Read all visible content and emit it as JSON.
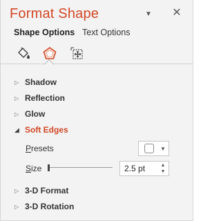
{
  "pane": {
    "title": "Format Shape",
    "dropdown_glyph": "▼",
    "close_glyph": "✕"
  },
  "tabs": {
    "shape_options": "Shape Options",
    "text_options": "Text Options"
  },
  "icons": {
    "fill": "fill-line-icon",
    "effects": "effects-icon",
    "size": "size-properties-icon"
  },
  "sections": {
    "shadow": "Shadow",
    "reflection": "Reflection",
    "glow": "Glow",
    "soft_edges": "Soft Edges",
    "format_3d": "3-D Format",
    "rotation_3d": "3-D Rotation"
  },
  "soft_edges": {
    "presets_label_access": "P",
    "presets_label_rest": "resets",
    "size_label_access": "S",
    "size_label_rest": "ize",
    "size_value": "2.5 pt",
    "size_fraction": 0.02
  },
  "colors": {
    "accent": "#d24726",
    "pane_bg": "#f3f3f3"
  }
}
